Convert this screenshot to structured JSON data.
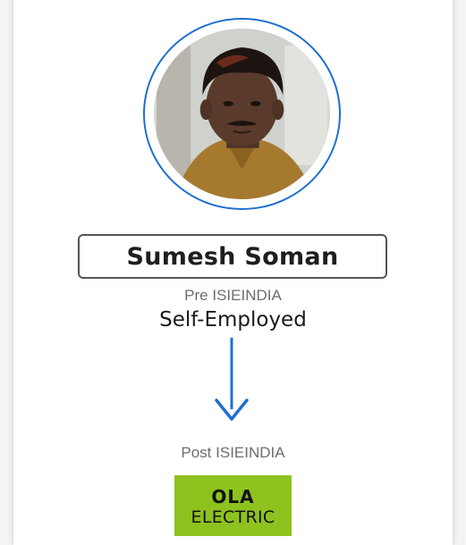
{
  "profile": {
    "name": "Sumesh Soman",
    "photo_alt": "profile photo"
  },
  "pre": {
    "label": "Pre ISIEINDIA",
    "value": "Self-Employed"
  },
  "post": {
    "label": "Post ISIEINDIA",
    "logo_line1": "OLA",
    "logo_line2": "ELECTRIC"
  },
  "colors": {
    "ring": "#1e6fd0",
    "arrow": "#1e6fd0",
    "logo_bg": "#8dc21f"
  },
  "icons": {
    "arrow": "arrow-down-icon"
  }
}
